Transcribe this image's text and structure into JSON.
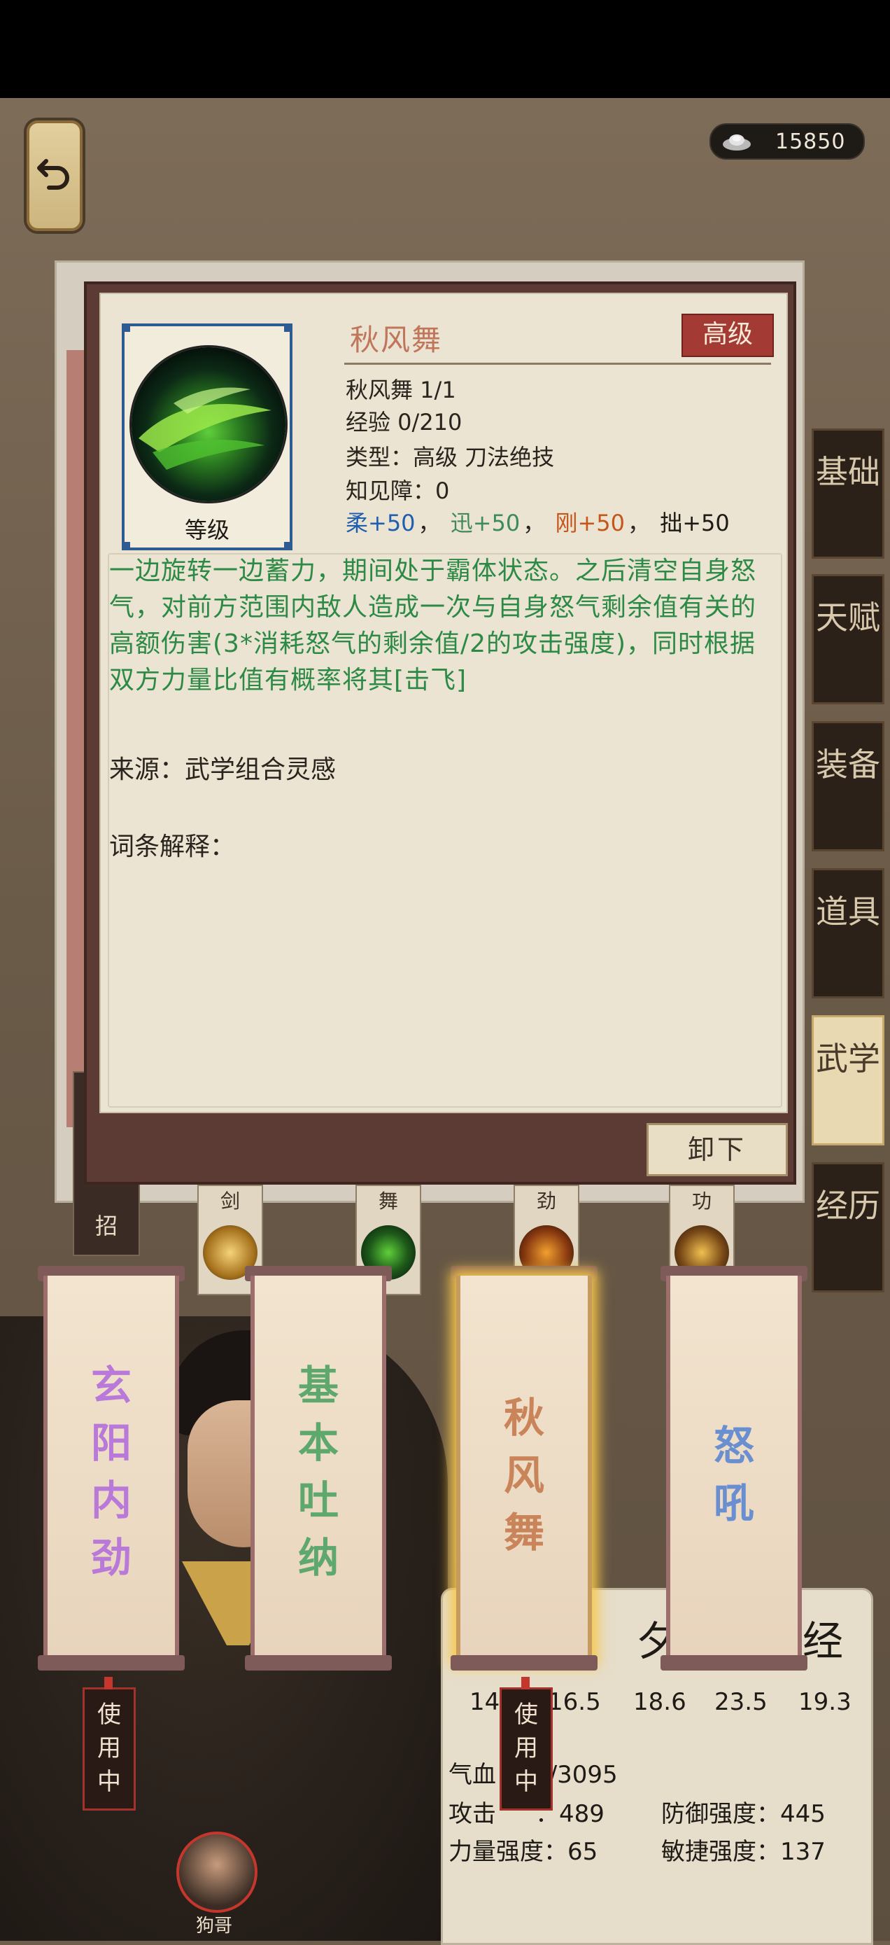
{
  "currency": {
    "icon": "silver-ingot-icon",
    "value": "15850"
  },
  "tabs": [
    {
      "label": "基础",
      "top": 0
    },
    {
      "label": "天赋"
    },
    {
      "label": "装备"
    },
    {
      "label": "道具"
    },
    {
      "label": "武学",
      "active": true
    },
    {
      "label": "经历"
    }
  ],
  "skill": {
    "icon_label": "等级",
    "name": "秋风舞",
    "grade": "高级",
    "level_line": "秋风舞 1/1",
    "exp_line": "经验 0/210",
    "type_line": "类型：高级 刀法绝技",
    "barrier_line": "知见障：0",
    "attrs": [
      {
        "text": "柔+50",
        "color": "#1f5fb0"
      },
      {
        "text": "，",
        "color": "#2a241e"
      },
      {
        "text": "迅+50",
        "color": "#3f8a5a"
      },
      {
        "text": "，",
        "color": "#2a241e"
      },
      {
        "text": "刚+50",
        "color": "#c4561c"
      },
      {
        "text": "，",
        "color": "#2a241e"
      },
      {
        "text": "拙+50",
        "color": "#1e1a16"
      }
    ],
    "description": "一边旋转一边蓄力，期间处于霸体状态。之后清空自身怒气，对前方范围内敌人造成一次与自身怒气剩余值有关的高额伤害(3*消耗怒气的剩余值/2的攻击强度)，同时根据双方力量比值有概率将其[击飞]",
    "source": "来源：武学组合灵感",
    "terms": "词条解释：",
    "unequip_label": "卸下"
  },
  "slots": [
    {
      "label": "剑"
    },
    {
      "label": "舞"
    },
    {
      "label": "劲"
    },
    {
      "label": "功"
    }
  ],
  "left_slot_label": "招",
  "scrolls": [
    {
      "title": "玄阳内劲",
      "color": "#b879d8"
    },
    {
      "title": "基本吐纳",
      "color": "#5ea86e"
    },
    {
      "title": "秋风舞",
      "color": "#c9845a",
      "active": true
    },
    {
      "title": "怒吼",
      "color": "#6a8fd0"
    }
  ],
  "in_use_label": "使用中",
  "character": {
    "name": "狗哥"
  },
  "stats": {
    "header_partial_left": "夕",
    "header_partial_right": "经",
    "values_row": [
      "14.",
      "16.5",
      "18.6",
      "23.5",
      "19.3"
    ],
    "hp": "气血 316/3095",
    "attack": "攻击",
    "attack_val": "：489",
    "defense": "防御强度：445",
    "strength": "力量强度：65",
    "agility": "敏捷强度：137"
  }
}
